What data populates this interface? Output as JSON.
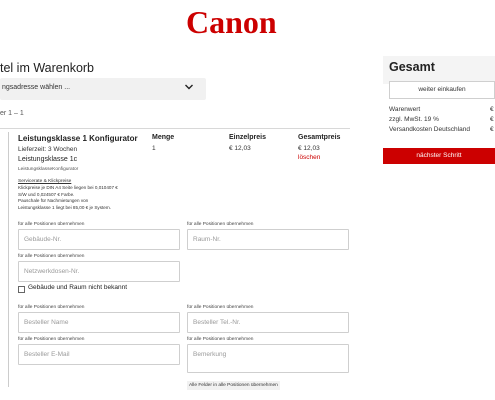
{
  "brand": {
    "logo_text": "Canon",
    "color": "#cc0000"
  },
  "cart": {
    "title": "tel im Warenkorb",
    "address_select": {
      "value": "ngsadresse wählen ..."
    },
    "count_text": "er 1 – 1"
  },
  "item": {
    "name": "Leistungsklasse 1 Konfigurator",
    "delivery": "Lieferzeit: 3 Wochen",
    "class_label": "Leistungsklasse 1c",
    "subtitle": "LeistungsklasseKonfigurator",
    "service_link": "Servicerate & Klickpreise",
    "service_note": [
      "Klickpreise je DIN A4 Seite liegen bei 0,010407 €",
      "S/W und 0,024507 € Farbe.",
      "Pauschale für Nachmietungen von",
      "Leistungsklasse 1 liegt bei 85,00 € je System."
    ],
    "columns": {
      "qty": "Menge",
      "unit_price": "Einzelpreis",
      "total_price": "Gesamtpreis"
    },
    "qty": "1",
    "unit_price": "€ 12,03",
    "total_price": "€ 12,03",
    "remove_label": "löschen"
  },
  "form": {
    "apply_label": "für alle Positionen übernehmen",
    "building_placeholder": "Gebäude-Nr.",
    "room_placeholder": "Raum-Nr.",
    "network_placeholder": "Netzwerkdosen-Nr.",
    "unknown_checkbox_label": "Gebäude und Raum nicht bekannt",
    "orderer_name_placeholder": "Besteller Name",
    "orderer_phone_placeholder": "Besteller Tel.-Nr.",
    "orderer_email_placeholder": "Besteller E-Mail",
    "remark_placeholder": "Bemerkung",
    "apply_all_label": "Alle Felder in alle Positionen übernehmen"
  },
  "summary": {
    "title": "Gesamt",
    "continue_label": "weiter einkaufen",
    "rows": [
      {
        "label": "Warenwert",
        "value": "€"
      },
      {
        "label": "zzgl. MwSt. 19 %",
        "value": "€"
      },
      {
        "label": "Versandkosten Deutschland",
        "value": "€"
      }
    ],
    "next_label": "nächster Schritt"
  }
}
